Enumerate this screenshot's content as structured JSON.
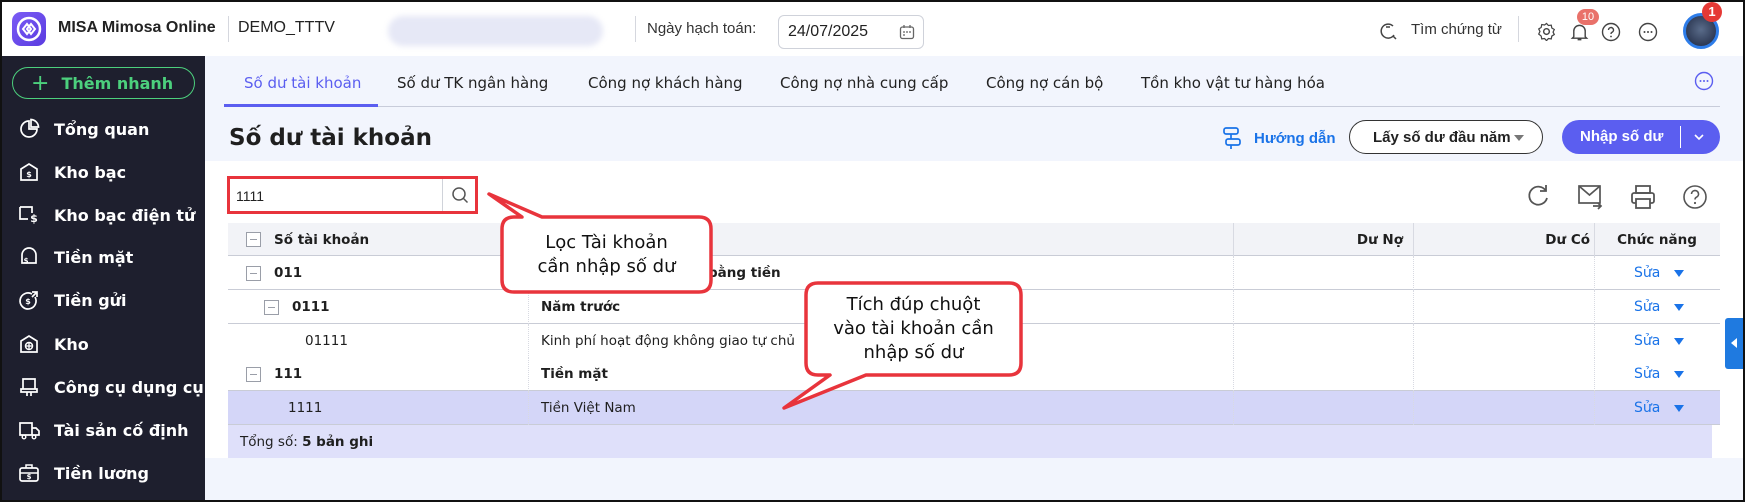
{
  "header": {
    "app_name": "MISA Mimosa Online",
    "tenant": "DEMO_TTTV",
    "date_label": "Ngày hạch toán:",
    "date_value": "24/07/2025",
    "search_docs": "Tìm chứng từ",
    "notification_count": "10",
    "avatar_badge": "1"
  },
  "sidebar": {
    "quick_add": "Thêm nhanh",
    "items": [
      {
        "label": "Tổng quan",
        "icon": "pie-chart-icon"
      },
      {
        "label": "Kho bạc",
        "icon": "treasury-icon"
      },
      {
        "label": "Kho bạc điện tử",
        "icon": "e-treasury-icon"
      },
      {
        "label": "Tiền mặt",
        "icon": "cash-icon"
      },
      {
        "label": "Tiền gửi",
        "icon": "deposit-icon"
      },
      {
        "label": "Kho",
        "icon": "warehouse-icon"
      },
      {
        "label": "Công cụ dụng cụ",
        "icon": "tools-icon"
      },
      {
        "label": "Tài sản cố định",
        "icon": "truck-icon"
      },
      {
        "label": "Tiền lương",
        "icon": "salary-icon"
      }
    ]
  },
  "tabs": [
    {
      "label": "Số dư tài khoản",
      "active": true
    },
    {
      "label": "Số dư TK ngân hàng"
    },
    {
      "label": "Công nợ khách hàng"
    },
    {
      "label": "Công nợ nhà cung cấp"
    },
    {
      "label": "Công nợ cán bộ"
    },
    {
      "label": "Tồn kho vật tư hàng hóa"
    }
  ],
  "page": {
    "title": "Số dư tài khoản",
    "guide": "Hướng dẫn",
    "get_opening": "Lấy số dư đầu năm",
    "enter_balance": "Nhập số dư",
    "search_value": "1111"
  },
  "table": {
    "columns": [
      "Số tài khoản",
      "",
      "Dư Nợ",
      "Dư Có",
      "Chức năng"
    ],
    "rows": [
      {
        "account": "011",
        "name": "bằng tiền",
        "bold": true,
        "level": 0,
        "action": "Sửa"
      },
      {
        "account": "0111",
        "name": "Năm trước",
        "bold": true,
        "level": 1,
        "action": "Sửa"
      },
      {
        "account": "01111",
        "name": "Kinh phí hoạt động không giao tự chủ",
        "bold": false,
        "level": 2,
        "action": "Sửa"
      },
      {
        "account": "111",
        "name": "Tiền mặt",
        "bold": true,
        "level": 0,
        "action": "Sửa"
      },
      {
        "account": "1111",
        "name": "Tiền Việt Nam",
        "bold": false,
        "level": 1,
        "action": "Sửa",
        "selected": true
      }
    ],
    "footer_label": "Tổng số:",
    "footer_count": "5 bản ghi"
  },
  "callouts": {
    "filter": [
      "Lọc Tài khoản",
      "cần nhập số dư"
    ],
    "double_click": [
      "Tích đúp chuột",
      "vào tài khoản cần",
      "nhập số dư"
    ]
  },
  "colors": {
    "accent": "#5b5ef0",
    "link": "#1a73e8",
    "sidebar_bg": "#1e1f2e",
    "quick_add": "#4cd07d",
    "selected_row": "#d4d6f8",
    "annotation": "#e8343c"
  }
}
